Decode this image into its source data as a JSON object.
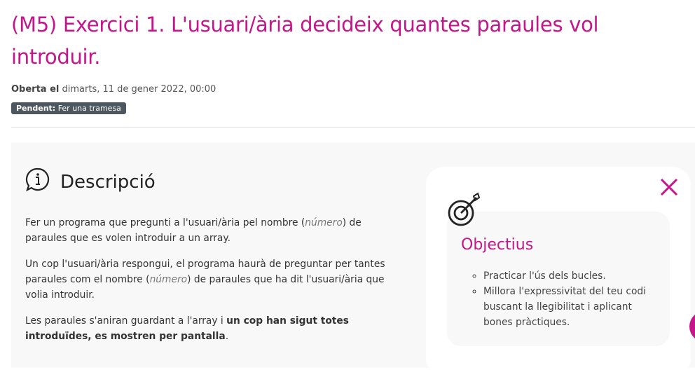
{
  "title": "(M5) Exercici 1. L'usuari/ària decideix quantes paraules vol introduir.",
  "opened_label": "Oberta el",
  "opened_date": "dimarts, 11 de gener 2022, 00:00",
  "status_label": "Pendent:",
  "status_value": "Fer una tramesa",
  "description": {
    "heading": "Descripció",
    "p1a": "Fer un programa que pregunti a l'usuari/ària pel nombre (",
    "p1i": "número",
    "p1b": ") de paraules que es volen introduir a un array.",
    "p2a": "Un cop l'usuari/ària respongui, el programa haurà de preguntar per tantes paraules com el nombre (",
    "p2i": "número",
    "p2b": ") de paraules que ha dit l'usuari/ària que volia introduir.",
    "p3a": "Les paraules s'aniran guardant a l'array i ",
    "p3b": "un cop han sigut totes introduïdes, es mostren per pantalla",
    "p3c": "."
  },
  "objectives": {
    "heading": "Objectius",
    "items": [
      "Practicar l'ús dels bucles.",
      "Millora l'expressivitat del teu codi buscant la llegibilitat i aplicant bones pràctiques."
    ]
  },
  "colors": {
    "accent": "#c4168a",
    "badge": "#4d5760",
    "panel": "#f8f8f8"
  }
}
